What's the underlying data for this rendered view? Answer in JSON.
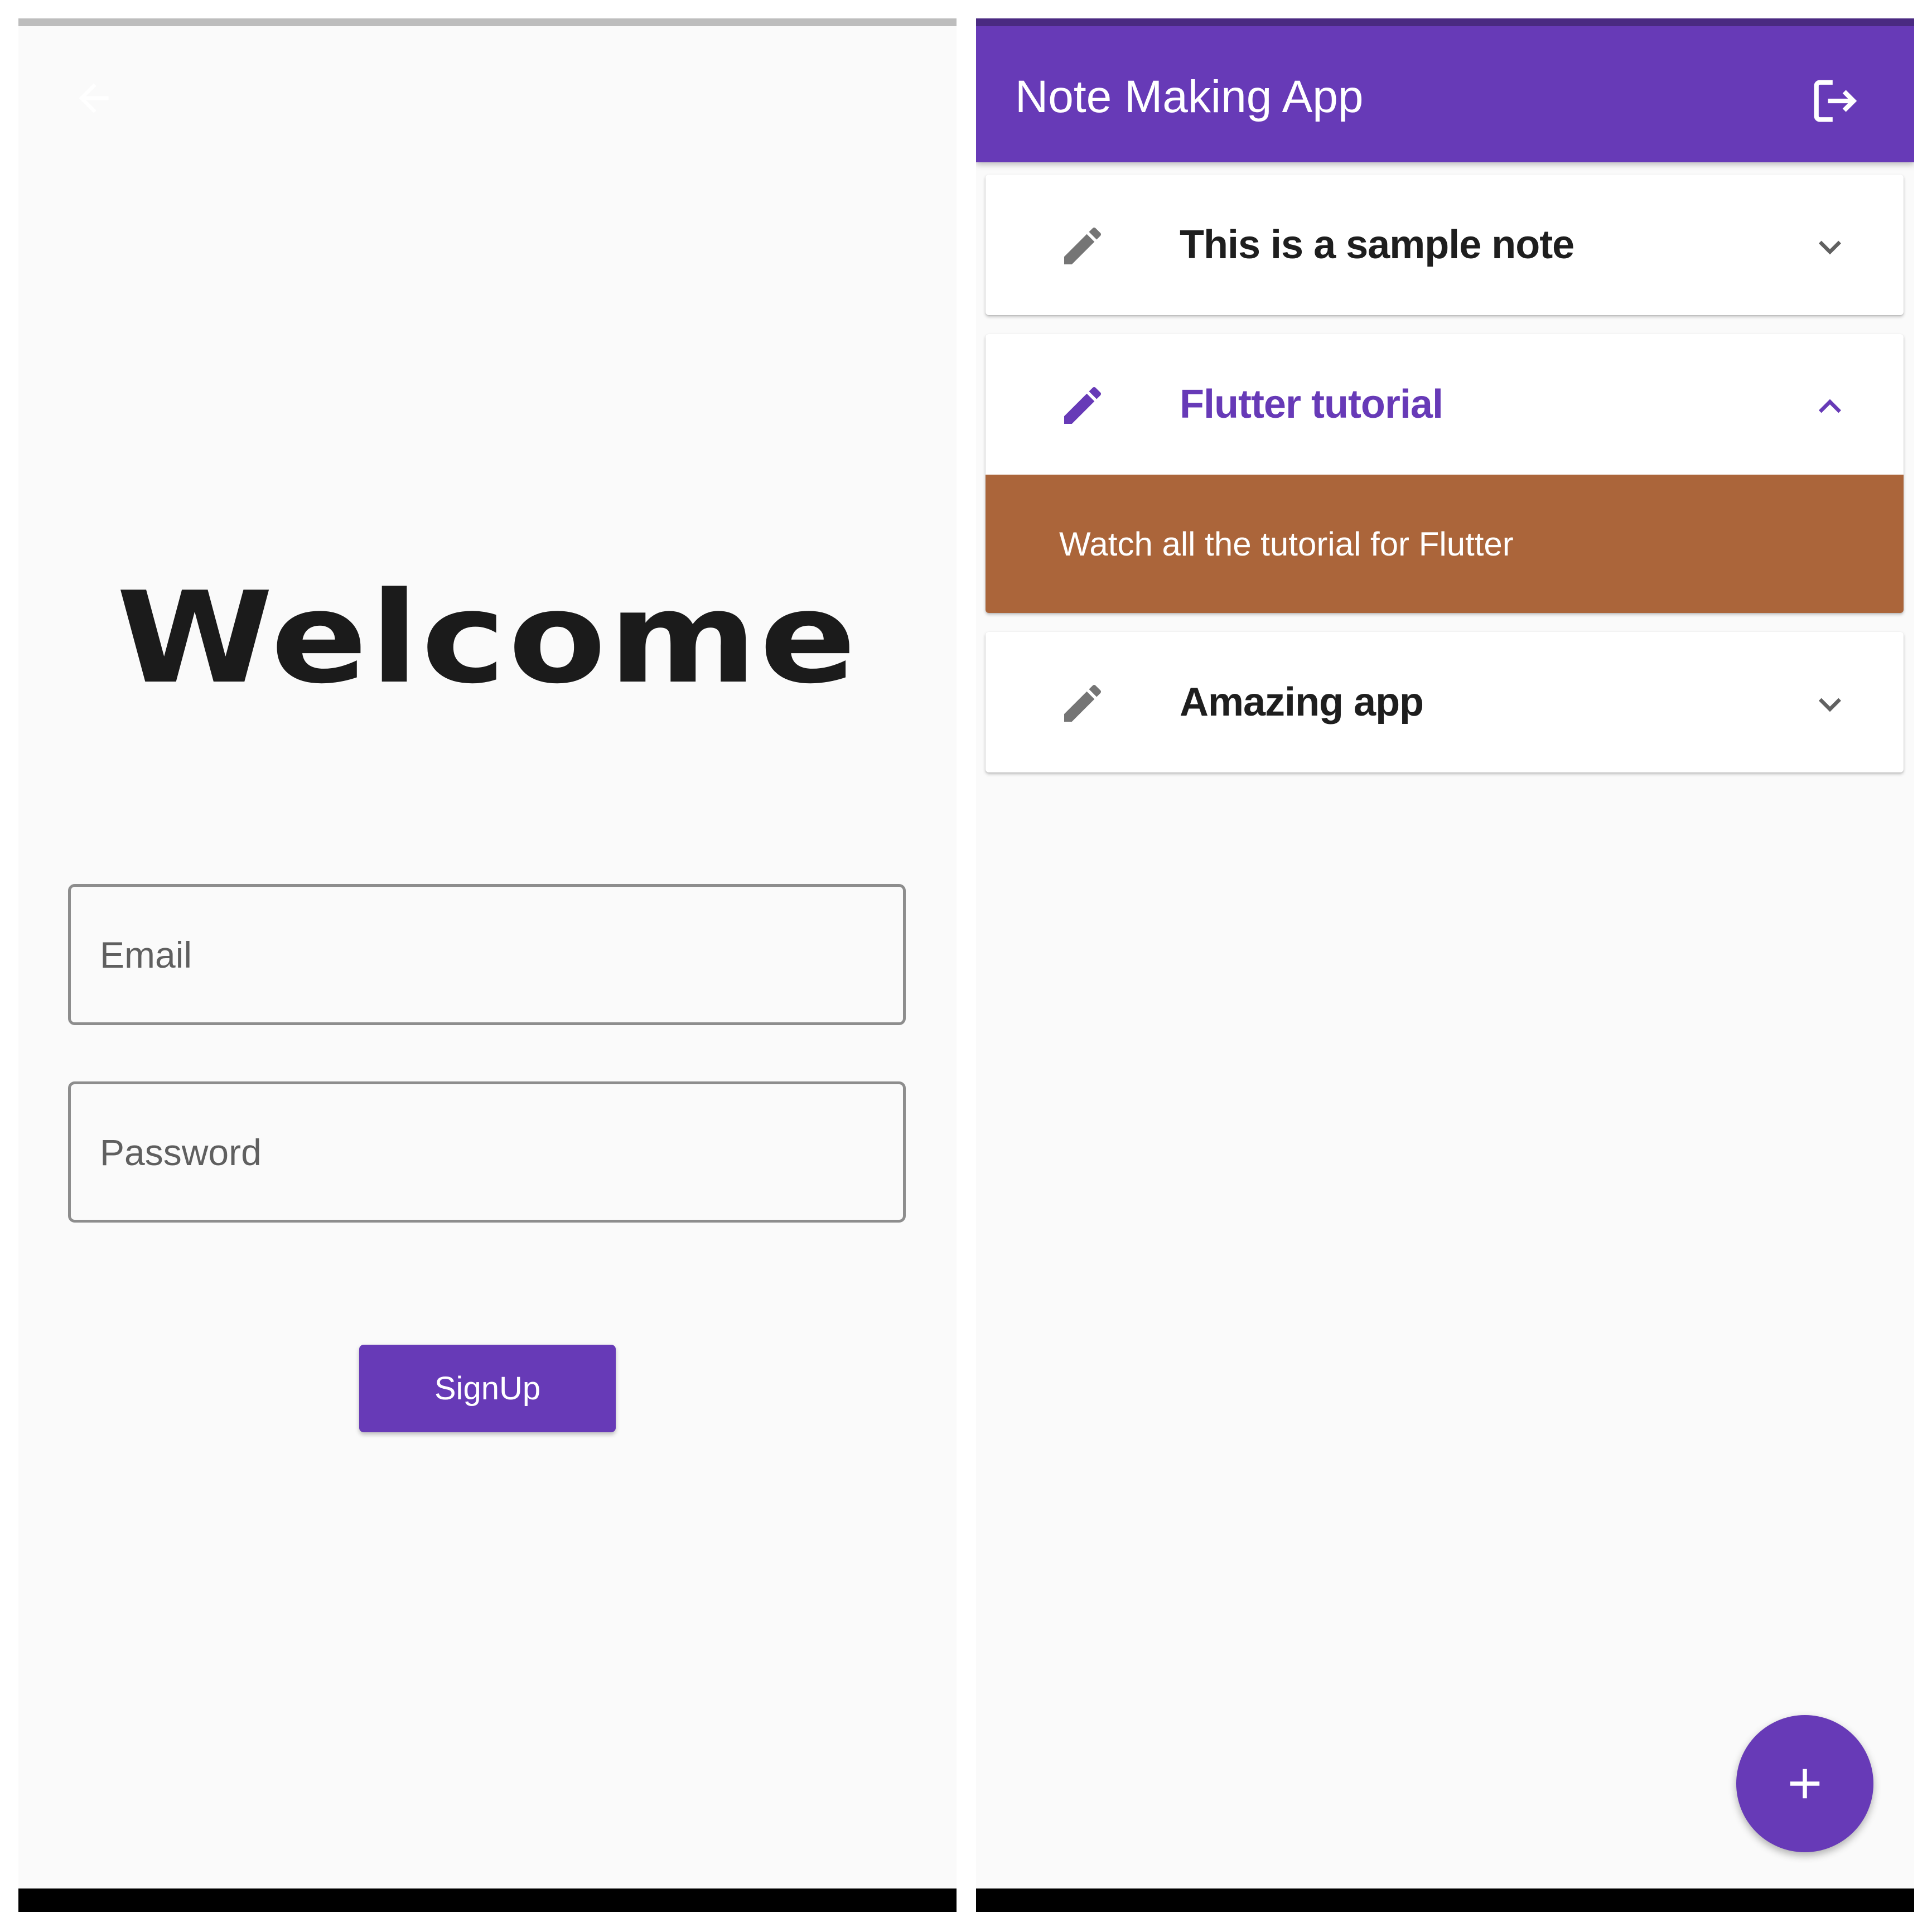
{
  "colors": {
    "primary": "#673ab7",
    "primary_dark": "#4a2a82",
    "note_body_bg": "#ab653a",
    "background": "#fafafa",
    "icon_grey": "#757575",
    "signup_strip": "#bdbdbd"
  },
  "signup_screen": {
    "back_icon": "arrow-back-icon",
    "title": "Welcome",
    "email": {
      "value": "",
      "placeholder": "Email"
    },
    "password": {
      "value": "",
      "placeholder": "Password"
    },
    "signup_label": "SignUp"
  },
  "notes_screen": {
    "app_bar": {
      "title": "Note Making App",
      "logout_icon": "logout-icon"
    },
    "notes": [
      {
        "title": "This is a sample note",
        "expanded": false,
        "icon": "edit-icon",
        "chevron": "chevron-down-icon"
      },
      {
        "title": "Flutter tutorial",
        "expanded": true,
        "icon": "edit-icon",
        "chevron": "chevron-up-icon",
        "body": "Watch all the tutorial for Flutter"
      },
      {
        "title": "Amazing app",
        "expanded": false,
        "icon": "edit-icon",
        "chevron": "chevron-down-icon"
      }
    ],
    "fab_icon": "add-icon"
  }
}
